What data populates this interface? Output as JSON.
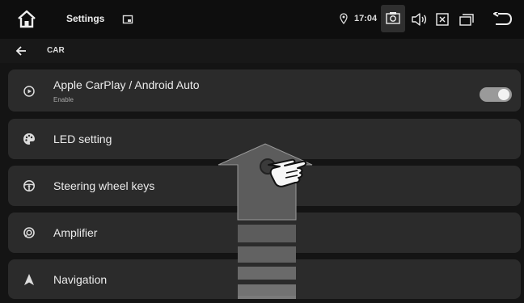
{
  "statusbar": {
    "title": "Settings",
    "time": "17:04",
    "icons": [
      "home-icon",
      "window-icon",
      "location-icon",
      "screenshot-icon",
      "volume-icon",
      "close-app-icon",
      "recent-apps-icon",
      "back-return-icon"
    ]
  },
  "subbar": {
    "section": "CAR"
  },
  "items": [
    {
      "label": "Apple CarPlay / Android Auto",
      "sub": "Enable",
      "icon": "carplay-icon",
      "toggle_on": true
    },
    {
      "label": "LED setting",
      "icon": "palette-icon"
    },
    {
      "label": "Steering wheel keys",
      "icon": "steering-wheel-icon"
    },
    {
      "label": "Amplifier",
      "icon": "amplifier-icon"
    },
    {
      "label": "Navigation",
      "icon": "navigation-arrow-icon"
    }
  ],
  "overlay": {
    "icons": [
      "swipe-up-arrow-icon",
      "pointing-hand-icon"
    ]
  },
  "colors": {
    "background": "#141414",
    "card": "#2b2b2b",
    "text": "#ececec",
    "toggle_track": "#9a9a9a"
  }
}
